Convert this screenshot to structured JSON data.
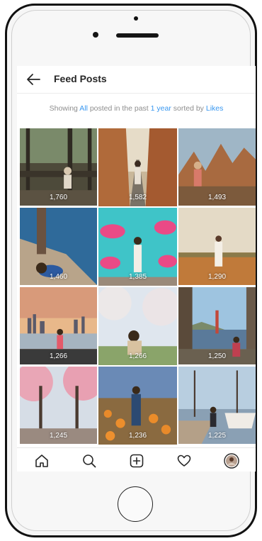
{
  "header": {
    "title": "Feed Posts"
  },
  "filter": {
    "prefix": "Showing ",
    "scope": "All",
    "middle": " posted in the past ",
    "period": "1 year",
    "sort_prefix": " sorted by ",
    "sort": "Likes"
  },
  "posts": [
    {
      "likes": "1,760"
    },
    {
      "likes": "1,582"
    },
    {
      "likes": "1,493"
    },
    {
      "likes": "1,460"
    },
    {
      "likes": "1,385"
    },
    {
      "likes": "1,290"
    },
    {
      "likes": "1,266"
    },
    {
      "likes": "1,266"
    },
    {
      "likes": "1,250"
    },
    {
      "likes": "1,245"
    },
    {
      "likes": "1,236"
    },
    {
      "likes": "1,225"
    }
  ],
  "tabs": [
    "home-icon",
    "search-icon",
    "add-post-icon",
    "heart-icon",
    "profile-avatar-icon"
  ],
  "colors": {
    "accent": "#3897f0",
    "text": "#262626",
    "muted": "#8e8e8e"
  }
}
